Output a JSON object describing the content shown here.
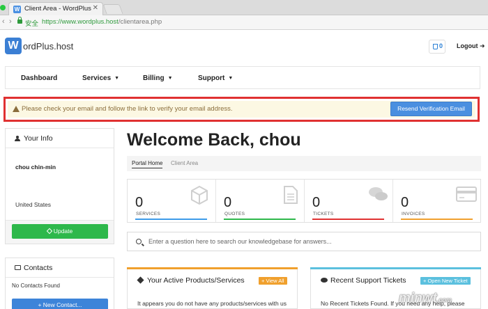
{
  "browser": {
    "tab_title": "Client Area - WordPlus",
    "tab_close": "✕",
    "secure_label": "安全",
    "url_base": "https://www.wordplus.host",
    "url_path": "/clientarea.php"
  },
  "header": {
    "logo_letter": "W",
    "logo_text": "ordPlus.host",
    "cart_count": "0",
    "logout_label": "Logout"
  },
  "nav": {
    "items": [
      {
        "label": "Dashboard",
        "has_caret": false
      },
      {
        "label": "Services",
        "has_caret": true
      },
      {
        "label": "Billing",
        "has_caret": true
      },
      {
        "label": "Support",
        "has_caret": true
      }
    ]
  },
  "alert": {
    "text": "Please check your email and follow the link to verify your email address.",
    "button_label": "Resend Verification Email"
  },
  "your_info": {
    "title": "Your Info",
    "name": "chou chin-min",
    "country": "United States",
    "update_label": "Update"
  },
  "contacts": {
    "title": "Contacts",
    "empty_text": "No Contacts Found",
    "new_label": "+ New Contact..."
  },
  "main": {
    "welcome": "Welcome Back, chou",
    "breadcrumb": {
      "home": "Portal Home",
      "current": "Client Area"
    },
    "search_placeholder": "Enter a question here to search our knowledgebase for answers..."
  },
  "stats": [
    {
      "value": "0",
      "label": "SERVICES",
      "color": "#3d9be9",
      "icon": "cube-icon"
    },
    {
      "value": "0",
      "label": "QUOTES",
      "color": "#2eb84b",
      "icon": "document-icon"
    },
    {
      "value": "0",
      "label": "TICKETS",
      "color": "#e03131",
      "icon": "comments-icon"
    },
    {
      "value": "0",
      "label": "INVOICES",
      "color": "#f0a02d",
      "icon": "credit-card-icon"
    }
  ],
  "cards": {
    "products": {
      "title": "Your Active Products/Services",
      "button_label": "+ View All",
      "text": "It appears you do not have any products/services with us",
      "accent": "#f0a02d"
    },
    "tickets": {
      "title": "Recent Support Tickets",
      "button_label": "+ Open New Ticket",
      "text": "No Recent Tickets Found. If you need any help, please",
      "accent": "#5bc0de"
    }
  },
  "watermark": {
    "text": "minwt",
    "suffix": ".com"
  }
}
